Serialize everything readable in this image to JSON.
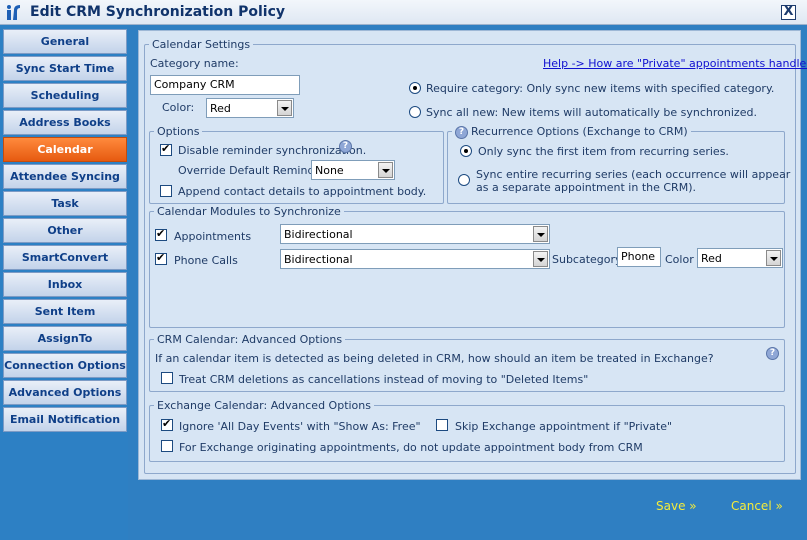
{
  "window": {
    "title": "Edit CRM Synchronization Policy",
    "close_glyph": "X"
  },
  "sidebar": {
    "items": [
      {
        "label": "General"
      },
      {
        "label": "Sync Start Time"
      },
      {
        "label": "Scheduling"
      },
      {
        "label": "Address Books"
      },
      {
        "label": "Calendar",
        "active": true
      },
      {
        "label": "Attendee Syncing"
      },
      {
        "label": "Task"
      },
      {
        "label": "Other"
      },
      {
        "label": "SmartConvert"
      },
      {
        "label": "Inbox"
      },
      {
        "label": "Sent Item"
      },
      {
        "label": "AssignTo"
      },
      {
        "label": "Connection Options"
      },
      {
        "label": "Advanced Options"
      },
      {
        "label": "Email Notification"
      }
    ]
  },
  "calendar_settings": {
    "legend": "Calendar Settings",
    "category_label": "Category name:",
    "category_value": "Company CRM",
    "color_label": "Color:",
    "color_value": "Red",
    "help_link": "Help -> How are \"Private\" appointments handled?",
    "require_category_label": "Require category: Only sync new items with specified category.",
    "sync_all_new_label": "Sync all new: New items will automatically be synchronized."
  },
  "options": {
    "legend": "Options",
    "disable_reminder_label": "Disable reminder synchronization.",
    "override_reminder_label": "Override Default Reminder",
    "override_reminder_value": "None",
    "append_contact_label": "Append contact details to appointment body."
  },
  "recurrence": {
    "legend": "Recurrence Options (Exchange to CRM)",
    "first_item_label": "Only sync the first item from recurring series.",
    "entire_series_label_1": "Sync entire recurring series (each occurrence will appear",
    "entire_series_label_2": "as a separate appointment in the CRM)."
  },
  "modules": {
    "legend": "Calendar Modules to Synchronize",
    "appointments_label": "Appointments",
    "appointments_value": "Bidirectional",
    "phone_calls_label": "Phone Calls",
    "phone_calls_value": "Bidirectional",
    "subcategory_label": "Subcategory:",
    "subcategory_value": "Phone",
    "color_label": "Color",
    "color_value": "Red"
  },
  "crm_advanced": {
    "legend": "CRM Calendar: Advanced Options",
    "description": "If an calendar item is detected as being deleted in CRM, how should an item be treated in Exchange?",
    "treat_deletions_label": "Treat CRM deletions as cancellations instead of moving to \"Deleted Items\""
  },
  "exchange_advanced": {
    "legend": "Exchange Calendar: Advanced Options",
    "ignore_all_day_label": "Ignore 'All Day Events' with \"Show As: Free\"",
    "skip_private_label": "Skip Exchange appointment if \"Private\"",
    "no_update_body_label": "For Exchange originating appointments, do not update appointment body from CRM"
  },
  "footer": {
    "save_label": "Save »",
    "cancel_label": "Cancel »"
  },
  "help_glyph": "?",
  "colors": {
    "accent_active": "#ff7a2a",
    "sidebar_bg": "#2d80c4",
    "panel_bg": "#d7e5f4",
    "footer_text": "#f5ec3a"
  }
}
